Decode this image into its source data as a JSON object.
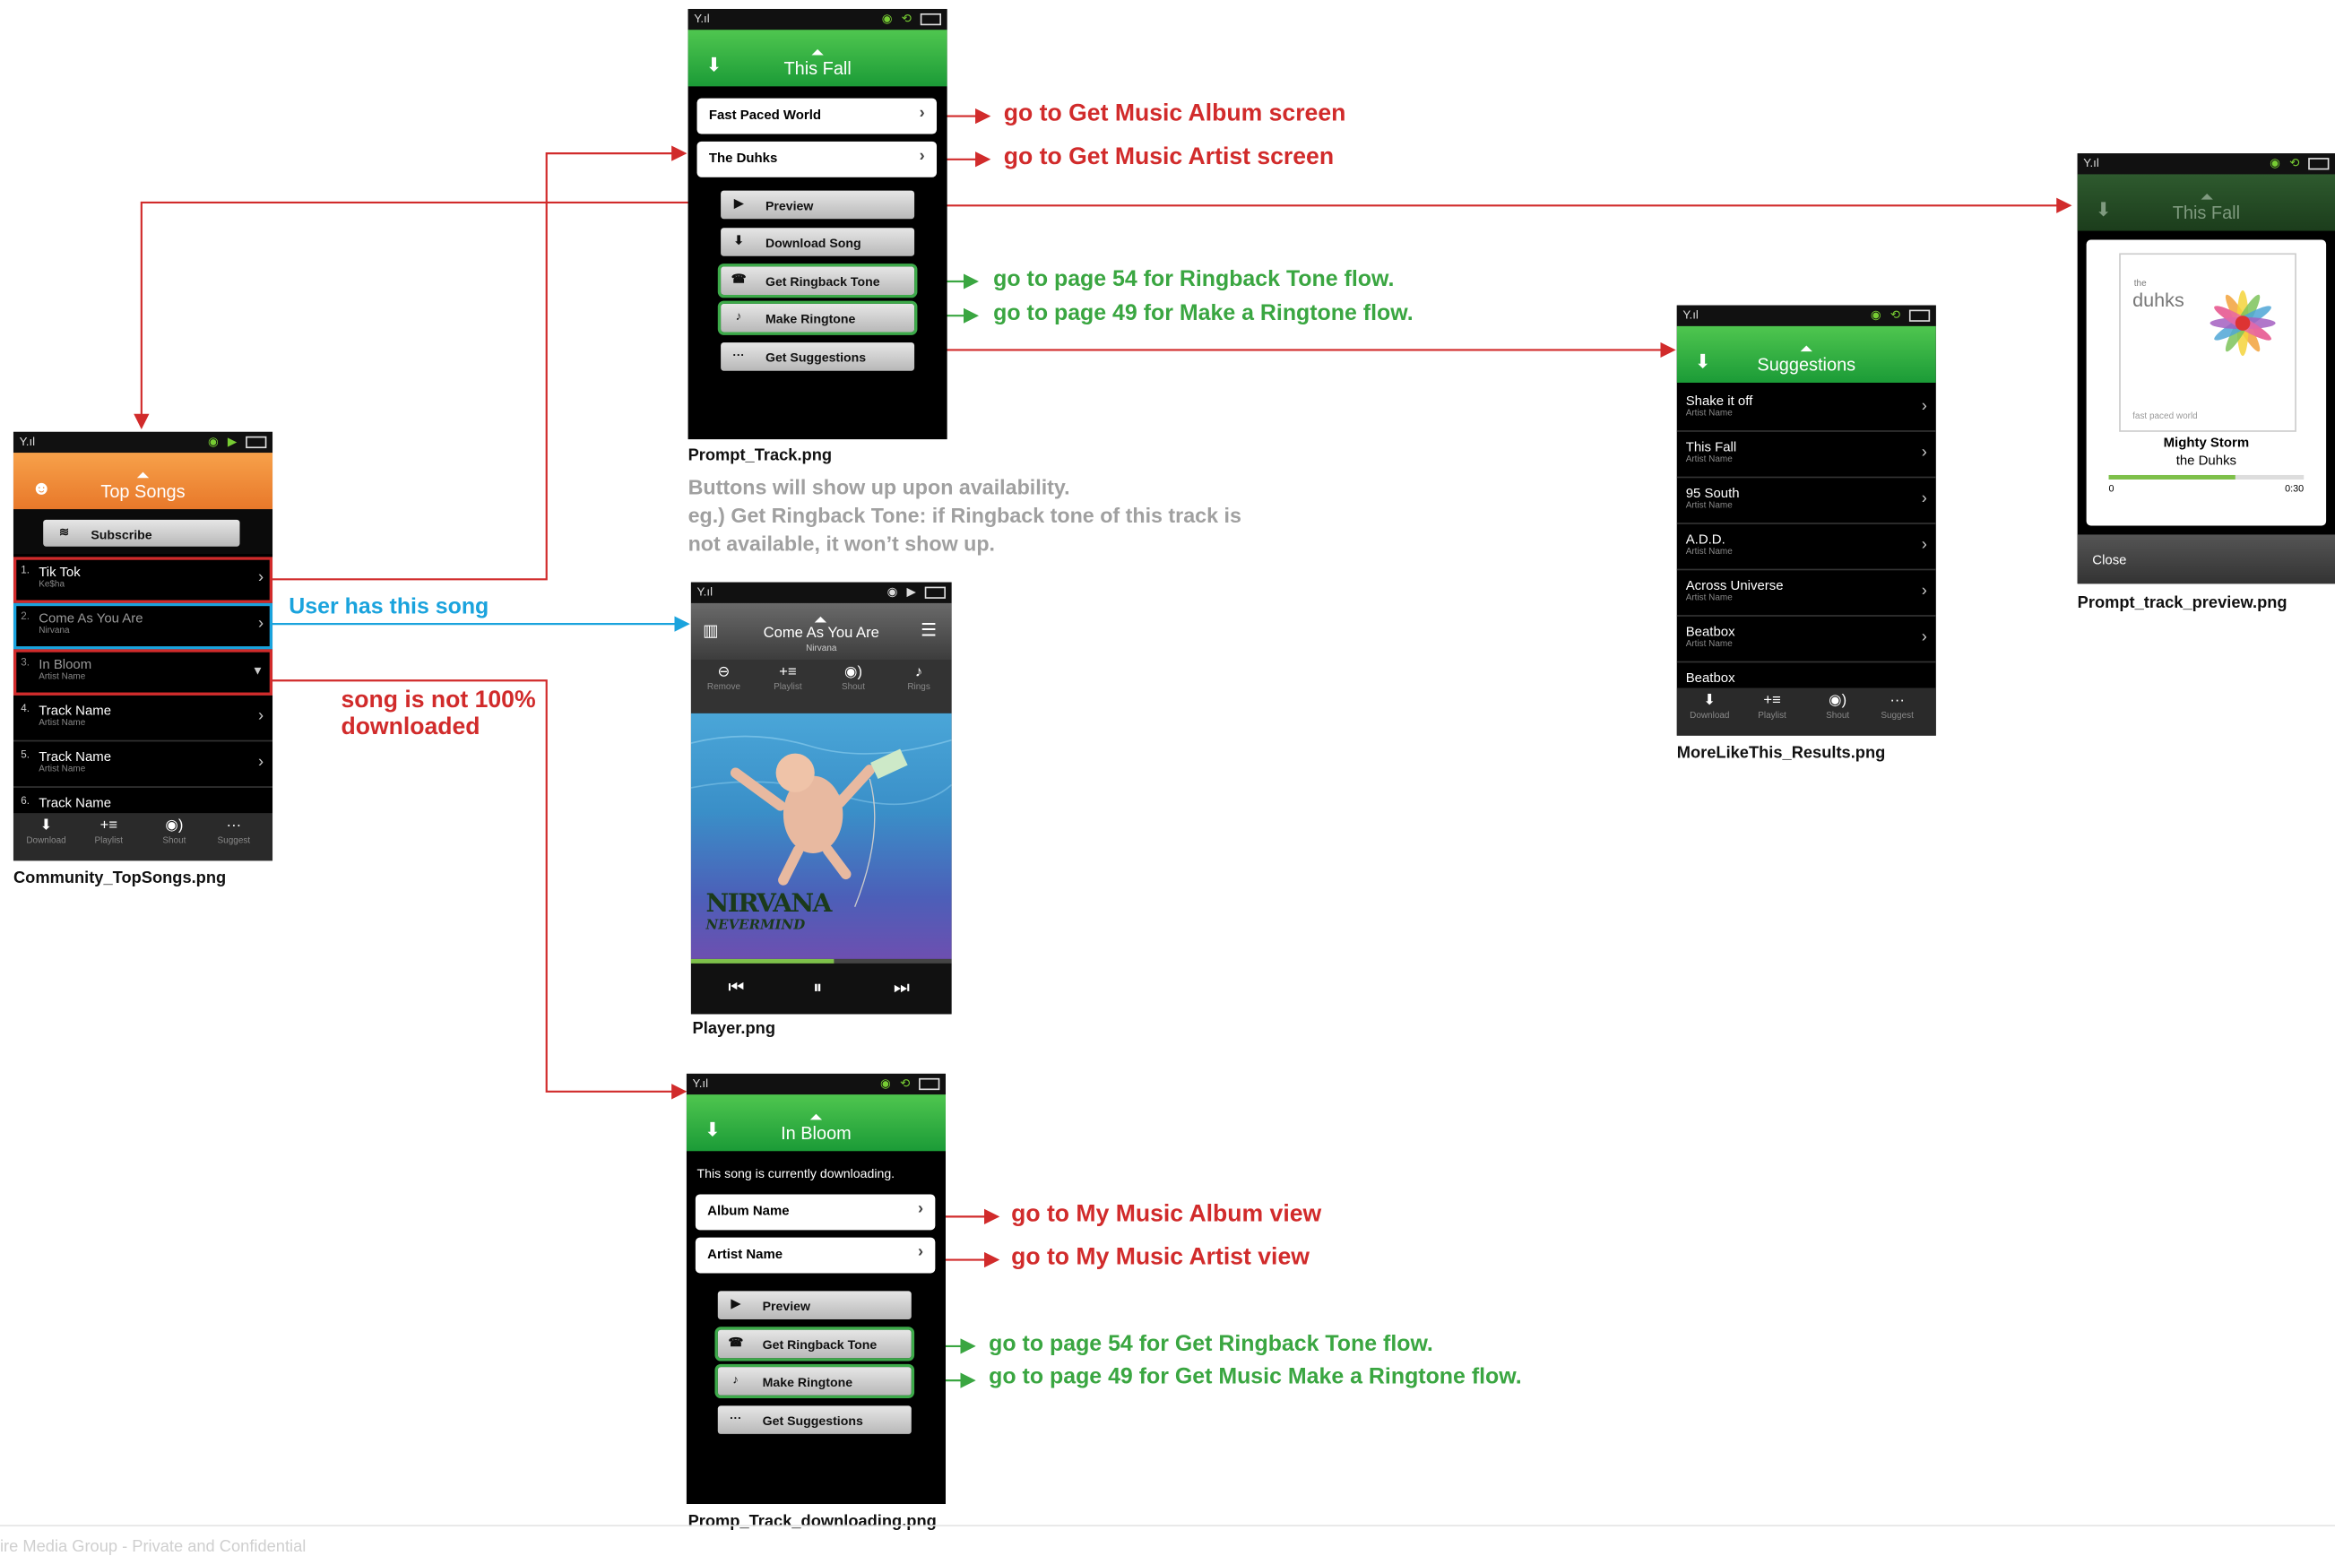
{
  "colors": {
    "red": "#d12b2b",
    "green": "#3aa641",
    "blue": "#1aa3dd",
    "gray": "#a0a0a0",
    "header_green": "#2aa63e",
    "header_orange": "#ee8a35"
  },
  "screens": {
    "community_top_songs": {
      "caption": "Community_TopSongs.png",
      "header_title": "Top Songs",
      "header_icon": "people-icon",
      "subscribe_label": "Subscribe",
      "rows": [
        {
          "num": "1.",
          "title": "Tik Tok",
          "sub": "Ke$ha"
        },
        {
          "num": "2.",
          "title": "Come As You Are",
          "sub": "Nirvana"
        },
        {
          "num": "3.",
          "title": "In Bloom",
          "sub": "Artist Name"
        },
        {
          "num": "4.",
          "title": "Track Name",
          "sub": "Artist Name"
        },
        {
          "num": "5.",
          "title": "Track Name",
          "sub": "Artist Name"
        },
        {
          "num": "6.",
          "title": "Track Name",
          "sub": ""
        }
      ],
      "tabs": [
        "Download",
        "Playlist",
        "Shout",
        "Suggest"
      ]
    },
    "prompt_track": {
      "caption": "Prompt_Track.png",
      "header_title": "This Fall",
      "album_label": "Fast Paced World",
      "artist_label": "The Duhks",
      "buttons": [
        "Preview",
        "Download Song",
        "Get Ringback Tone",
        "Make Ringtone",
        "Get Suggestions"
      ]
    },
    "player": {
      "caption": "Player.png",
      "title": "Come As You Are",
      "subtitle": "Nirvana",
      "actions": [
        "Remove",
        "Playlist",
        "Shout",
        "Rings"
      ],
      "album_text_1": "NIRVANA",
      "album_text_2": "NEVERMIND",
      "progress": 0.55
    },
    "prompt_track_downloading": {
      "caption": "Promp_Track_downloading.png",
      "header_title": "In Bloom",
      "message": "This song is currently downloading.",
      "album_label": "Album Name",
      "artist_label": "Artist Name",
      "buttons": [
        "Preview",
        "Get Ringback Tone",
        "Make Ringtone",
        "Get Suggestions"
      ]
    },
    "more_like_this": {
      "caption": "MoreLikeThis_Results.png",
      "header_title": "Suggestions",
      "rows": [
        {
          "title": "Shake it off",
          "sub": "Artist Name"
        },
        {
          "title": "This Fall",
          "sub": "Artist Name"
        },
        {
          "title": "95 South",
          "sub": "Artist Name"
        },
        {
          "title": "A.D.D.",
          "sub": "Artist Name"
        },
        {
          "title": "Across Universe",
          "sub": "Artist Name"
        },
        {
          "title": "Beatbox",
          "sub": "Artist Name"
        },
        {
          "title": "Beatbox",
          "sub": ""
        }
      ],
      "tabs": [
        "Download",
        "Playlist",
        "Shout",
        "Suggest"
      ]
    },
    "prompt_track_preview": {
      "caption": "Prompt_track_preview.png",
      "header_title": "This Fall",
      "album_brand_small": "the",
      "album_brand": "duhks",
      "album_footer": "fast paced world",
      "song": "Mighty Storm",
      "artist": "the Duhks",
      "time_start": "0",
      "time_end": "0:30",
      "progress": 0.65,
      "close_label": "Close"
    }
  },
  "annotations": {
    "album_screen": "go to Get Music Album screen",
    "artist_screen": "go to Get Music Artist screen",
    "ringback_54": "go to page 54 for Ringback Tone flow.",
    "ringtone_49": "go to page 49 for Make a Ringtone flow.",
    "availability_line1": "Buttons will show up upon availability.",
    "availability_line2": "eg.) Get Ringback Tone: if Ringback tone of this track is",
    "availability_line3": "not available, it won’t show up.",
    "user_has_song": "User has this song",
    "not_downloaded_1": "song is not 100%",
    "not_downloaded_2": "downloaded",
    "my_music_album": "go to My Music Album view",
    "my_music_artist": "go to My Music Artist view",
    "get_ringback_54": "go to page 54 for Get Ringback Tone flow.",
    "get_ringtone_49": "go to page 49 for Get Music Make a Ringtone flow."
  },
  "footer": "ire Media Group - Private and Confidential"
}
